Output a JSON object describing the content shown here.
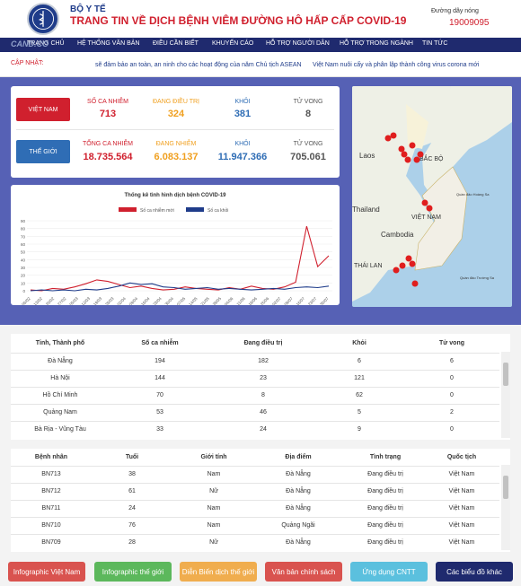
{
  "header": {
    "org": "BỘ Y TẾ",
    "title": "TRANG TIN VỀ DỊCH BỆNH VIÊM ĐƯỜNG HÔ HẤP CẤP COVID-19",
    "hotline_label": "Đường dây nóng",
    "hotline": "19009095",
    "watermark": "CAND.CO"
  },
  "nav": [
    "TRANG CHỦ",
    "HỆ THỐNG VĂN BẢN",
    "ĐIỀU CẦN BIẾT",
    "KHUYẾN CÁO",
    "HỖ TRỢ NGƯỜI DÂN",
    "HỖ TRỢ TRONG NGÀNH",
    "TIN TỨC"
  ],
  "ticker": {
    "label": "CẬP NHẬT:",
    "items": [
      "sẽ đảm bảo an toàn, an ninh cho các hoạt động của năm Chủ tịch ASEAN",
      "Việt Nam nuôi cấy và phân lập thành công virus corona mới"
    ]
  },
  "stats": {
    "vietnam": {
      "button": "VIỆT NAM",
      "labels": [
        "SỐ CA NHIỄM",
        "ĐANG ĐIỀU TRỊ",
        "KHỎI",
        "TỬ VONG"
      ],
      "values": [
        "713",
        "324",
        "381",
        "8"
      ]
    },
    "world": {
      "button": "THẾ GIỚI",
      "labels": [
        "TỔNG CA NHIỄM",
        "ĐANG NHIỄM",
        "KHỎI",
        "TỬ VONG"
      ],
      "values": [
        "18.735.564",
        "6.083.137",
        "11.947.366",
        "705.061"
      ]
    },
    "colors": [
      "#d0202e",
      "#f0a020",
      "#2f6db5",
      "#555555"
    ]
  },
  "chart_data": {
    "type": "line",
    "title": "Thống kê tình hình dịch bệnh COVID-19",
    "ylim": [
      0,
      90
    ],
    "yticks": [
      0,
      10,
      20,
      30,
      40,
      50,
      60,
      70,
      80,
      90
    ],
    "x": [
      "06/02",
      "13/02",
      "20/02",
      "27/02",
      "05/03",
      "12/03",
      "19/03",
      "26/03",
      "02/04",
      "09/04",
      "16/04",
      "23/04",
      "30/04",
      "07/05",
      "14/05",
      "21/05",
      "28/05",
      "04/06",
      "11/06",
      "18/06",
      "25/06",
      "02/07",
      "09/07",
      "16/07",
      "23/07",
      "30/07"
    ],
    "series": [
      {
        "name": "Số ca nhiễm mới",
        "color": "#d0202e",
        "values": [
          1,
          0,
          3,
          2,
          5,
          9,
          14,
          12,
          8,
          4,
          6,
          3,
          1,
          2,
          5,
          3,
          2,
          1,
          4,
          2,
          6,
          3,
          2,
          5,
          11,
          83,
          31,
          45
        ]
      },
      {
        "name": "Số ca khỏi",
        "color": "#1f3c8a",
        "values": [
          0,
          1,
          0,
          1,
          0,
          2,
          1,
          3,
          6,
          10,
          8,
          9,
          5,
          4,
          2,
          3,
          4,
          2,
          3,
          2,
          1,
          2,
          3,
          2,
          4,
          5,
          4,
          6
        ]
      }
    ],
    "legend": "top-center"
  },
  "map": {
    "labels": [
      "Laos",
      "BẮC BỘ",
      "Thailand",
      "Cambodia",
      "VIỆT NAM",
      "THÁI LAN",
      "Quần đảo Hoàng Sa",
      "Quần đảo Trường Sa"
    ]
  },
  "provinces": {
    "headers": [
      "Tỉnh, Thành phố",
      "Số ca nhiễm",
      "Đang điều trị",
      "Khỏi",
      "Tử vong"
    ],
    "rows": [
      [
        "Đà Nẵng",
        "194",
        "182",
        "6",
        "6"
      ],
      [
        "Hà Nội",
        "144",
        "23",
        "121",
        "0"
      ],
      [
        "Hồ Chí Minh",
        "70",
        "8",
        "62",
        "0"
      ],
      [
        "Quảng Nam",
        "53",
        "46",
        "5",
        "2"
      ],
      [
        "Bà Rịa - Vũng Tàu",
        "33",
        "24",
        "9",
        "0"
      ]
    ]
  },
  "patients": {
    "headers": [
      "Bệnh nhân",
      "Tuổi",
      "Giới tính",
      "Địa điểm",
      "Tình trạng",
      "Quốc tịch"
    ],
    "rows": [
      [
        "BN713",
        "38",
        "Nam",
        "Đà Nẵng",
        "Đang điều trị",
        "Việt Nam"
      ],
      [
        "BN712",
        "61",
        "Nữ",
        "Đà Nẵng",
        "Đang điều trị",
        "Việt Nam"
      ],
      [
        "BN711",
        "24",
        "Nam",
        "Đà Nẵng",
        "Đang điều trị",
        "Việt Nam"
      ],
      [
        "BN710",
        "76",
        "Nam",
        "Quảng Ngãi",
        "Đang điều trị",
        "Việt Nam"
      ],
      [
        "BN709",
        "28",
        "Nữ",
        "Đà Nẵng",
        "Đang điều trị",
        "Việt Nam"
      ]
    ]
  },
  "footer": [
    {
      "label": "Infographic Việt Nam",
      "color": "#d9534f"
    },
    {
      "label": "Infographic thế giới",
      "color": "#5cb85c"
    },
    {
      "label": "Diễn Biến dịch thế giới",
      "color": "#f0ad4e"
    },
    {
      "label": "Văn bản chính sách",
      "color": "#d9534f"
    },
    {
      "label": "Ứng dụng CNTT",
      "color": "#5bc0de"
    },
    {
      "label": "Các biểu đồ khác",
      "color": "#1f2a6e"
    }
  ]
}
